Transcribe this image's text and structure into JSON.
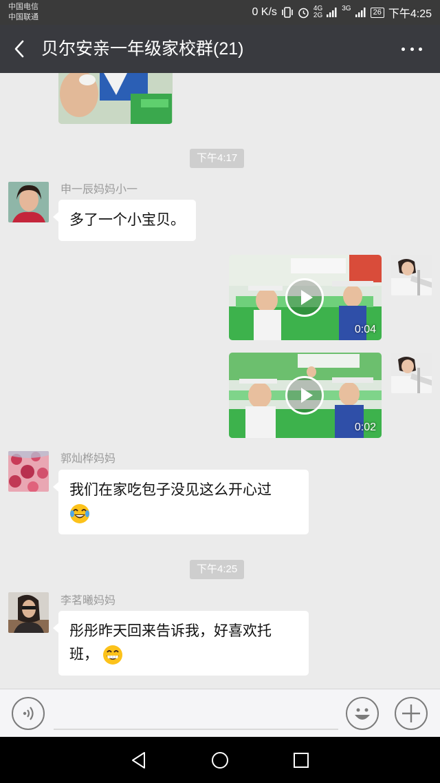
{
  "status_bar": {
    "carrier_1": "中国电信",
    "carrier_2": "中国联通",
    "speed": "0 K/s",
    "net_1": "4G",
    "net_2": "2G",
    "net_3": "3G",
    "battery": "26",
    "time": "下午4:25"
  },
  "header": {
    "title": "贝尔安亲一年级家校群(21)",
    "back_icon": "chevron-left-icon",
    "more_icon": "more-dots-icon"
  },
  "chat": {
    "time_1": "下午4:17",
    "time_2": "下午4:25",
    "messages": [
      {
        "sender": "申一辰妈妈小一",
        "text": "多了一个小宝贝。"
      },
      {
        "duration": "0:04"
      },
      {
        "duration": "0:02"
      },
      {
        "sender": "郭灿桦妈妈",
        "line_1": "我们在家吃包子没见这么开心过",
        "emoji": "tears-of-joy-emoji"
      },
      {
        "sender": "李茗曦妈妈",
        "line_1": "彤彤昨天回来告诉我，好喜欢托",
        "line_2": "班，",
        "emoji": "grinning-emoji"
      }
    ]
  },
  "input_bar": {
    "voice_icon": "voice-icon",
    "emoji_icon": "smiley-icon",
    "plus_icon": "plus-icon"
  },
  "nav_bar": {
    "back_icon": "nav-back-icon",
    "home_icon": "nav-home-icon",
    "recents_icon": "nav-recents-icon"
  },
  "colors": {
    "title_bar": "#393a3f",
    "chat_bg": "#ebebeb",
    "time_pill": "#cecece"
  }
}
